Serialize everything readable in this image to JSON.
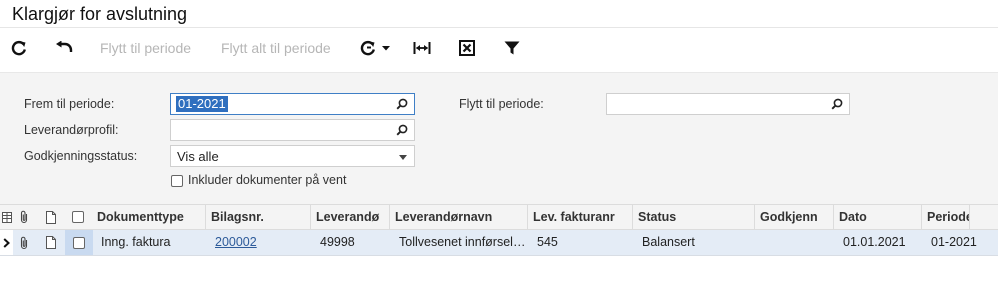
{
  "title": "Klargjør for avslutning",
  "toolbar": {
    "refresh_icon": "refresh-icon",
    "undo_icon": "undo-icon",
    "move_to_period": "Flytt til periode",
    "move_all_to_period": "Flytt alt til periode",
    "actions_icon": "refresh-dropdown-icon",
    "fit_columns_icon": "fit-columns-icon",
    "export_icon": "export-excel-icon",
    "filter_icon": "filter-icon"
  },
  "form": {
    "from_period_label": "Frem til periode:",
    "from_period_value": "01-2021",
    "vendor_profile_label": "Leverandørprofil:",
    "vendor_profile_value": "",
    "approval_status_label": "Godkjenningsstatus:",
    "approval_status_value": "Vis alle",
    "include_pending_label": "Inkluder dokumenter på vent",
    "include_pending_checked": false,
    "move_to_period_label": "Flytt til periode:",
    "move_to_period_value": ""
  },
  "grid": {
    "columns": [
      "Dokumenttype",
      "Bilagsnr.",
      "Leverandø",
      "Leverandørnavn",
      "Lev. fakturanr",
      "Status",
      "Godkjenn",
      "Dato",
      "Periode"
    ],
    "rows": [
      {
        "document_type": "Inng. faktura",
        "voucher_no": "200002",
        "vendor": "49998",
        "vendor_name": "Tollvesenet innførsel…",
        "vendor_invoice_no": "545",
        "status": "Balansert",
        "approved": "",
        "date": "01.01.2021",
        "period": "01-2021"
      }
    ]
  },
  "colors": {
    "accent": "#2f6fbf",
    "link": "#2d5b9a",
    "row_selected": "#e4ecf6",
    "disabled_text": "#b6b6b6"
  }
}
